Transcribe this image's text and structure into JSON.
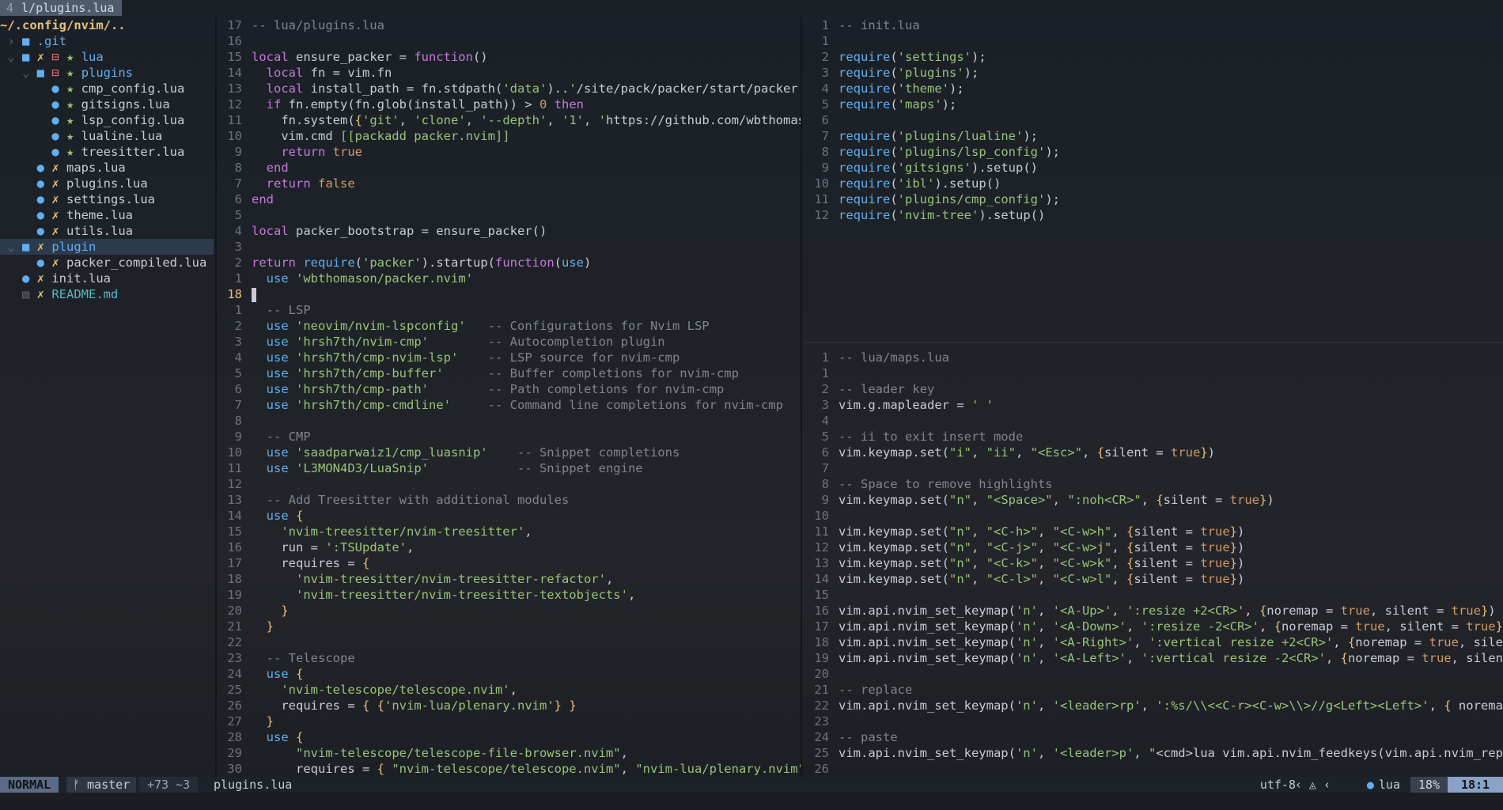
{
  "tab": {
    "index": "4",
    "label": "l/plugins.lua"
  },
  "tree": {
    "root": "~/.config/nvim/..",
    "items": [
      {
        "indent": 1,
        "arrow": "›",
        "icon": "folder",
        "status": "",
        "label": ".git",
        "kind": "dir"
      },
      {
        "indent": 1,
        "arrow": "⌄",
        "icon": "folder",
        "status": "x",
        "extra": "minus",
        "mod": "star",
        "label": "lua",
        "kind": "dir"
      },
      {
        "indent": 2,
        "arrow": "⌄",
        "icon": "folder",
        "status": "",
        "extra": "minus",
        "mod": "star",
        "label": "plugins",
        "kind": "dir"
      },
      {
        "indent": 3,
        "icon": "lua",
        "mod": "star",
        "label": "cmp_config.lua",
        "kind": "file"
      },
      {
        "indent": 3,
        "icon": "lua",
        "mod": "star",
        "label": "gitsigns.lua",
        "kind": "file"
      },
      {
        "indent": 3,
        "icon": "lua",
        "mod": "star",
        "label": "lsp_config.lua",
        "kind": "file"
      },
      {
        "indent": 3,
        "icon": "lua",
        "mod": "star",
        "label": "lualine.lua",
        "kind": "file"
      },
      {
        "indent": 3,
        "icon": "lua",
        "mod": "star",
        "label": "treesitter.lua",
        "kind": "file"
      },
      {
        "indent": 2,
        "icon": "lua",
        "mod": "x",
        "label": "maps.lua",
        "kind": "file"
      },
      {
        "indent": 2,
        "icon": "lua",
        "mod": "x",
        "label": "plugins.lua",
        "kind": "file"
      },
      {
        "indent": 2,
        "icon": "lua",
        "mod": "x",
        "label": "settings.lua",
        "kind": "file"
      },
      {
        "indent": 2,
        "icon": "lua",
        "mod": "x",
        "label": "theme.lua",
        "kind": "file"
      },
      {
        "indent": 2,
        "icon": "lua",
        "mod": "x",
        "label": "utils.lua",
        "kind": "file"
      },
      {
        "indent": 1,
        "arrow": "⌄",
        "icon": "folder",
        "mod": "x",
        "label": "plugin",
        "kind": "dir",
        "selected": true
      },
      {
        "indent": 2,
        "icon": "lua",
        "mod": "x",
        "label": "packer_compiled.lua",
        "kind": "file"
      },
      {
        "indent": 1,
        "icon": "lua",
        "mod": "x",
        "label": "init.lua",
        "kind": "file"
      },
      {
        "indent": 1,
        "icon": "md",
        "mod": "x",
        "label": "README.md",
        "kind": "md"
      }
    ]
  },
  "left_pane": {
    "lines": [
      [
        "17",
        "-- lua/plugins.lua"
      ],
      [
        "16",
        ""
      ],
      [
        "15",
        "local ensure_packer = function()"
      ],
      [
        "14",
        "  local fn = vim.fn"
      ],
      [
        "13",
        "  local install_path = fn.stdpath('data')..'/site/pack/packer/start/packer.nv"
      ],
      [
        "12",
        "  if fn.empty(fn.glob(install_path)) > 0 then"
      ],
      [
        "11",
        "    fn.system({'git', 'clone', '--depth', '1', 'https://github.com/wbthomason"
      ],
      [
        "10",
        "    vim.cmd [[packadd packer.nvim]]"
      ],
      [
        "9",
        "    return true"
      ],
      [
        "8",
        "  end"
      ],
      [
        "7",
        "  return false"
      ],
      [
        "6",
        "end"
      ],
      [
        "5",
        ""
      ],
      [
        "4",
        "local packer_bootstrap = ensure_packer()"
      ],
      [
        "3",
        ""
      ],
      [
        "2",
        "return require('packer').startup(function(use)"
      ],
      [
        "1",
        "  use 'wbthomason/packer.nvim'"
      ],
      [
        "18",
        ""
      ],
      [
        "1",
        "  -- LSP"
      ],
      [
        "2",
        "  use 'neovim/nvim-lspconfig'   -- Configurations for Nvim LSP"
      ],
      [
        "3",
        "  use 'hrsh7th/nvim-cmp'        -- Autocompletion plugin"
      ],
      [
        "4",
        "  use 'hrsh7th/cmp-nvim-lsp'    -- LSP source for nvim-cmp"
      ],
      [
        "5",
        "  use 'hrsh7th/cmp-buffer'      -- Buffer completions for nvim-cmp"
      ],
      [
        "6",
        "  use 'hrsh7th/cmp-path'        -- Path completions for nvim-cmp"
      ],
      [
        "7",
        "  use 'hrsh7th/cmp-cmdline'     -- Command line completions for nvim-cmp"
      ],
      [
        "8",
        ""
      ],
      [
        "9",
        "  -- CMP"
      ],
      [
        "10",
        "  use 'saadparwaiz1/cmp_luasnip'    -- Snippet completions"
      ],
      [
        "11",
        "  use 'L3MON4D3/LuaSnip'            -- Snippet engine"
      ],
      [
        "12",
        ""
      ],
      [
        "13",
        "  -- Add Treesitter with additional modules"
      ],
      [
        "14",
        "  use {"
      ],
      [
        "15",
        "    'nvim-treesitter/nvim-treesitter',"
      ],
      [
        "16",
        "    run = ':TSUpdate',"
      ],
      [
        "17",
        "    requires = {"
      ],
      [
        "18",
        "      'nvim-treesitter/nvim-treesitter-refactor',"
      ],
      [
        "19",
        "      'nvim-treesitter/nvim-treesitter-textobjects',"
      ],
      [
        "20",
        "    }"
      ],
      [
        "21",
        "  }"
      ],
      [
        "22",
        ""
      ],
      [
        "23",
        "  -- Telescope"
      ],
      [
        "24",
        "  use {"
      ],
      [
        "25",
        "    'nvim-telescope/telescope.nvim',"
      ],
      [
        "26",
        "    requires = { {'nvim-lua/plenary.nvim'} }"
      ],
      [
        "27",
        "  }"
      ],
      [
        "28",
        "  use {"
      ],
      [
        "29",
        "      \"nvim-telescope/telescope-file-browser.nvim\","
      ],
      [
        "30",
        "      requires = { \"nvim-telescope/telescope.nvim\", \"nvim-lua/plenary.nvim\" }"
      ]
    ]
  },
  "rtop_pane": {
    "lines": [
      [
        "1",
        "-- init.lua"
      ],
      [
        "1",
        ""
      ],
      [
        "2",
        "require('settings');"
      ],
      [
        "3",
        "require('plugins');"
      ],
      [
        "4",
        "require('theme');"
      ],
      [
        "5",
        "require('maps');"
      ],
      [
        "6",
        ""
      ],
      [
        "7",
        "require('plugins/lualine');"
      ],
      [
        "8",
        "require('plugins/lsp_config');"
      ],
      [
        "9",
        "require('gitsigns').setup()"
      ],
      [
        "10",
        "require('ibl').setup()"
      ],
      [
        "11",
        "require('plugins/cmp_config');"
      ],
      [
        "12",
        "require('nvim-tree').setup()"
      ]
    ]
  },
  "rbot_pane": {
    "lines": [
      [
        "1",
        "-- lua/maps.lua"
      ],
      [
        "1",
        ""
      ],
      [
        "2",
        "-- leader key"
      ],
      [
        "3",
        "vim.g.mapleader = ' '"
      ],
      [
        "4",
        ""
      ],
      [
        "5",
        "-- ii to exit insert mode"
      ],
      [
        "6",
        "vim.keymap.set(\"i\", \"ii\", \"<Esc>\", {silent = true})"
      ],
      [
        "7",
        ""
      ],
      [
        "8",
        "-- Space to remove highlights"
      ],
      [
        "9",
        "vim.keymap.set(\"n\", \"<Space>\", \":noh<CR>\", {silent = true})"
      ],
      [
        "10",
        ""
      ],
      [
        "11",
        "vim.keymap.set(\"n\", \"<C-h>\", \"<C-w>h\", {silent = true})"
      ],
      [
        "12",
        "vim.keymap.set(\"n\", \"<C-j>\", \"<C-w>j\", {silent = true})"
      ],
      [
        "13",
        "vim.keymap.set(\"n\", \"<C-k>\", \"<C-w>k\", {silent = true})"
      ],
      [
        "14",
        "vim.keymap.set(\"n\", \"<C-l>\", \"<C-w>l\", {silent = true})"
      ],
      [
        "15",
        ""
      ],
      [
        "16",
        "vim.api.nvim_set_keymap('n', '<A-Up>', ':resize +2<CR>', {noremap = true, silent = true})"
      ],
      [
        "17",
        "vim.api.nvim_set_keymap('n', '<A-Down>', ':resize -2<CR>', {noremap = true, silent = true})"
      ],
      [
        "18",
        "vim.api.nvim_set_keymap('n', '<A-Right>', ':vertical resize +2<CR>', {noremap = true, silent ="
      ],
      [
        "19",
        "vim.api.nvim_set_keymap('n', '<A-Left>', ':vertical resize -2<CR>', {noremap = true, silent ="
      ],
      [
        "20",
        ""
      ],
      [
        "21",
        "-- replace"
      ],
      [
        "22",
        "vim.api.nvim_set_keymap('n', '<leader>rp', ':%s/\\\\<<C-r><C-w>\\\\>//g<Left><Left>', { noremap ="
      ],
      [
        "23",
        ""
      ],
      [
        "24",
        "-- paste"
      ],
      [
        "25",
        "vim.api.nvim_set_keymap('n', '<leader>p', \"<cmd>lua vim.api.nvim_feedkeys(vim.api.nvim_replace"
      ],
      [
        "26",
        ""
      ]
    ]
  },
  "status": {
    "mode": "NORMAL",
    "branch": "master",
    "diff": "+73 ~3",
    "filename": "plugins.lua",
    "encoding": "utf-8",
    "filetype": "lua",
    "percent": "18%",
    "position": "18:1"
  }
}
